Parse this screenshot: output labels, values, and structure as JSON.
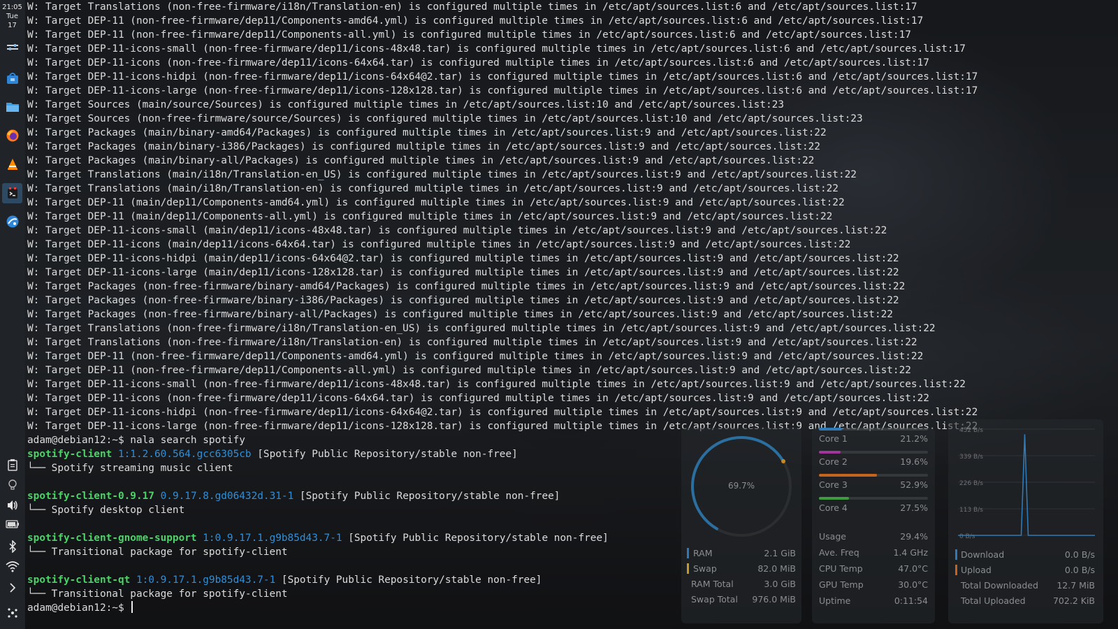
{
  "dock": {
    "clock": {
      "time": "21:05",
      "day": "Tue",
      "date": "17"
    },
    "battery_percent": "86%"
  },
  "terminal": {
    "lines": [
      "W: Target Translations (non-free-firmware/i18n/Translation-en) is configured multiple times in /etc/apt/sources.list:6 and /etc/apt/sources.list:17",
      "W: Target DEP-11 (non-free-firmware/dep11/Components-amd64.yml) is configured multiple times in /etc/apt/sources.list:6 and /etc/apt/sources.list:17",
      "W: Target DEP-11 (non-free-firmware/dep11/Components-all.yml) is configured multiple times in /etc/apt/sources.list:6 and /etc/apt/sources.list:17",
      "W: Target DEP-11-icons-small (non-free-firmware/dep11/icons-48x48.tar) is configured multiple times in /etc/apt/sources.list:6 and /etc/apt/sources.list:17",
      "W: Target DEP-11-icons (non-free-firmware/dep11/icons-64x64.tar) is configured multiple times in /etc/apt/sources.list:6 and /etc/apt/sources.list:17",
      "W: Target DEP-11-icons-hidpi (non-free-firmware/dep11/icons-64x64@2.tar) is configured multiple times in /etc/apt/sources.list:6 and /etc/apt/sources.list:17",
      "W: Target DEP-11-icons-large (non-free-firmware/dep11/icons-128x128.tar) is configured multiple times in /etc/apt/sources.list:6 and /etc/apt/sources.list:17",
      "W: Target Sources (main/source/Sources) is configured multiple times in /etc/apt/sources.list:10 and /etc/apt/sources.list:23",
      "W: Target Sources (non-free-firmware/source/Sources) is configured multiple times in /etc/apt/sources.list:10 and /etc/apt/sources.list:23",
      "W: Target Packages (main/binary-amd64/Packages) is configured multiple times in /etc/apt/sources.list:9 and /etc/apt/sources.list:22",
      "W: Target Packages (main/binary-i386/Packages) is configured multiple times in /etc/apt/sources.list:9 and /etc/apt/sources.list:22",
      "W: Target Packages (main/binary-all/Packages) is configured multiple times in /etc/apt/sources.list:9 and /etc/apt/sources.list:22",
      "W: Target Translations (main/i18n/Translation-en_US) is configured multiple times in /etc/apt/sources.list:9 and /etc/apt/sources.list:22",
      "W: Target Translations (main/i18n/Translation-en) is configured multiple times in /etc/apt/sources.list:9 and /etc/apt/sources.list:22",
      "W: Target DEP-11 (main/dep11/Components-amd64.yml) is configured multiple times in /etc/apt/sources.list:9 and /etc/apt/sources.list:22",
      "W: Target DEP-11 (main/dep11/Components-all.yml) is configured multiple times in /etc/apt/sources.list:9 and /etc/apt/sources.list:22",
      "W: Target DEP-11-icons-small (main/dep11/icons-48x48.tar) is configured multiple times in /etc/apt/sources.list:9 and /etc/apt/sources.list:22",
      "W: Target DEP-11-icons (main/dep11/icons-64x64.tar) is configured multiple times in /etc/apt/sources.list:9 and /etc/apt/sources.list:22",
      "W: Target DEP-11-icons-hidpi (main/dep11/icons-64x64@2.tar) is configured multiple times in /etc/apt/sources.list:9 and /etc/apt/sources.list:22",
      "W: Target DEP-11-icons-large (main/dep11/icons-128x128.tar) is configured multiple times in /etc/apt/sources.list:9 and /etc/apt/sources.list:22",
      "W: Target Packages (non-free-firmware/binary-amd64/Packages) is configured multiple times in /etc/apt/sources.list:9 and /etc/apt/sources.list:22",
      "W: Target Packages (non-free-firmware/binary-i386/Packages) is configured multiple times in /etc/apt/sources.list:9 and /etc/apt/sources.list:22",
      "W: Target Packages (non-free-firmware/binary-all/Packages) is configured multiple times in /etc/apt/sources.list:9 and /etc/apt/sources.list:22",
      "W: Target Translations (non-free-firmware/i18n/Translation-en_US) is configured multiple times in /etc/apt/sources.list:9 and /etc/apt/sources.list:22",
      "W: Target Translations (non-free-firmware/i18n/Translation-en) is configured multiple times in /etc/apt/sources.list:9 and /etc/apt/sources.list:22",
      "W: Target DEP-11 (non-free-firmware/dep11/Components-amd64.yml) is configured multiple times in /etc/apt/sources.list:9 and /etc/apt/sources.list:22",
      "W: Target DEP-11 (non-free-firmware/dep11/Components-all.yml) is configured multiple times in /etc/apt/sources.list:9 and /etc/apt/sources.list:22",
      "W: Target DEP-11-icons-small (non-free-firmware/dep11/icons-48x48.tar) is configured multiple times in /etc/apt/sources.list:9 and /etc/apt/sources.list:22",
      "W: Target DEP-11-icons (non-free-firmware/dep11/icons-64x64.tar) is configured multiple times in /etc/apt/sources.list:9 and /etc/apt/sources.list:22",
      "W: Target DEP-11-icons-hidpi (non-free-firmware/dep11/icons-64x64@2.tar) is configured multiple times in /etc/apt/sources.list:9 and /etc/apt/sources.list:22",
      "W: Target DEP-11-icons-large (non-free-firmware/dep11/icons-128x128.tar) is configured multiple times in /etc/apt/sources.list:9 and /etc/apt/sources.list:22"
    ],
    "command_line": "adam@debian12:~$ nala search spotify",
    "results": [
      {
        "name": "spotify-client",
        "version": "1:1.2.60.564.gcc6305cb",
        "repo": "[Spotify Public Repository/stable non-free]",
        "desc": "└── Spotify streaming music client"
      },
      {
        "name": "spotify-client-0.9.17",
        "version": "0.9.17.8.gd06432d.31-1",
        "repo": "[Spotify Public Repository/stable non-free]",
        "desc": "└── Spotify desktop client"
      },
      {
        "name": "spotify-client-gnome-support",
        "version": "1:0.9.17.1.g9b85d43.7-1",
        "repo": "[Spotify Public Repository/stable non-free]",
        "desc": "└── Transitional package for spotify-client"
      },
      {
        "name": "spotify-client-qt",
        "version": "1:0.9.17.1.g9b85d43.7-1",
        "repo": "[Spotify Public Repository/stable non-free]",
        "desc": "└── Transitional package for spotify-client"
      }
    ],
    "prompt": "adam@debian12:~$ "
  },
  "memory_widget": {
    "gauge_label": "69.7%",
    "gauge_fraction": 0.697,
    "rows": [
      {
        "label": "RAM",
        "value": "2.1 GiB"
      },
      {
        "label": "Swap",
        "value": "82.0 MiB"
      },
      {
        "label": "RAM Total",
        "value": "3.0 GiB"
      },
      {
        "label": "Swap Total",
        "value": "976.0 MiB"
      }
    ]
  },
  "cpu_widget": {
    "cores": [
      {
        "label": "Core 1",
        "value": "21.2%",
        "fraction": 0.212,
        "color": "#2e7ab8"
      },
      {
        "label": "Core 2",
        "value": "19.6%",
        "fraction": 0.196,
        "color": "#a0369a"
      },
      {
        "label": "Core 3",
        "value": "52.9%",
        "fraction": 0.529,
        "color": "#c4641f"
      },
      {
        "label": "Core 4",
        "value": "27.5%",
        "fraction": 0.275,
        "color": "#3e9a3e"
      }
    ],
    "stats": [
      {
        "label": "Usage",
        "value": "29.4%"
      },
      {
        "label": "Ave. Freq",
        "value": "1.4 GHz"
      },
      {
        "label": "CPU Temp",
        "value": "47.0°C"
      },
      {
        "label": "GPU Temp",
        "value": "30.0°C"
      },
      {
        "label": "Uptime",
        "value": "0:11:54"
      }
    ]
  },
  "network_widget": {
    "axis_labels": [
      "452 B/s",
      "339 B/s",
      "226 B/s",
      "113 B/s",
      "0 B/s"
    ],
    "chart_data": {
      "type": "line",
      "series": [
        {
          "values": [
            0,
            0,
            0,
            0,
            0,
            0,
            0,
            0,
            0,
            0,
            0,
            0,
            0,
            0,
            0,
            0,
            0,
            0,
            0,
            430,
            0,
            0,
            0,
            0,
            0,
            0,
            0,
            0,
            0,
            0,
            0,
            0,
            0,
            0,
            0,
            0,
            0,
            0,
            0,
            0
          ]
        }
      ],
      "ylim": [
        0,
        452
      ]
    },
    "rows": [
      {
        "label": "Download",
        "value": "0.0 B/s"
      },
      {
        "label": "Upload",
        "value": "0.0 B/s"
      },
      {
        "label": "Total Downloaded",
        "value": "12.7 MiB"
      },
      {
        "label": "Total Uploaded",
        "value": "702.2 KiB"
      }
    ]
  }
}
